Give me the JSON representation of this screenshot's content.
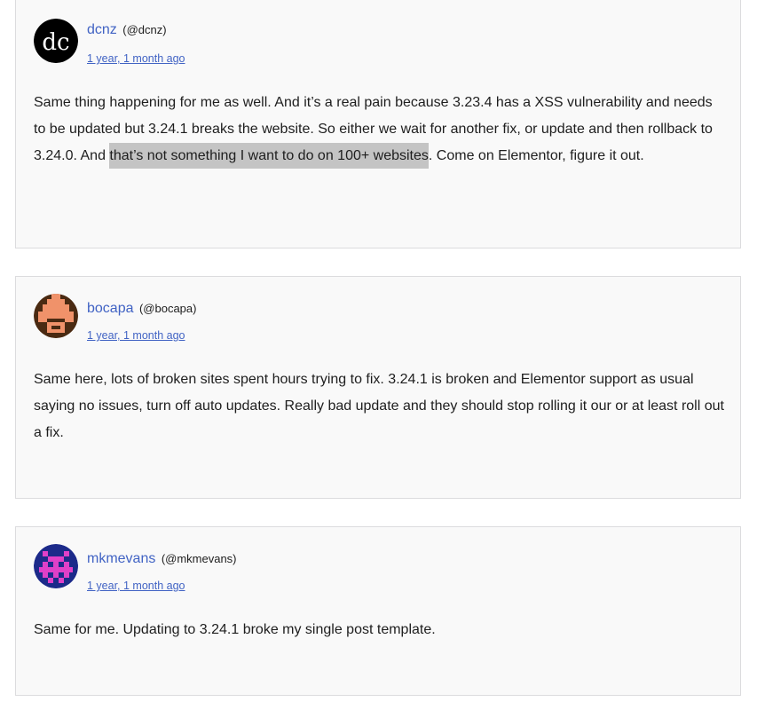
{
  "replies": [
    {
      "author": "dcnz",
      "handle": "(@dcnz)",
      "avatar_text": "dc",
      "time": "1 year, 1 month ago",
      "body_before": "Same thing happening for me as well. And it’s a real pain because 3.23.4 has a XSS vulnerability and needs to be updated but 3.24.1 breaks the website. So either we wait for another fix, or update and then rollback to 3.24.0. And ",
      "body_highlight": "that’s not something I want to do on 100+ websites",
      "body_after": ". Come on Elementor, figure it out."
    },
    {
      "author": "bocapa",
      "handle": "(@bocapa)",
      "time": "1 year, 1 month ago",
      "body": "Same here, lots of broken sites spent hours trying to fix. 3.24.1 is broken and Elementor support as usual saying no issues, turn off auto updates. Really bad update and they should stop rolling it our or at least roll out a fix."
    },
    {
      "author": "mkmevans",
      "handle": "(@mkmevans)",
      "time": "1 year, 1 month ago",
      "body": "Same for me. Updating to 3.24.1 broke my single post template."
    }
  ]
}
